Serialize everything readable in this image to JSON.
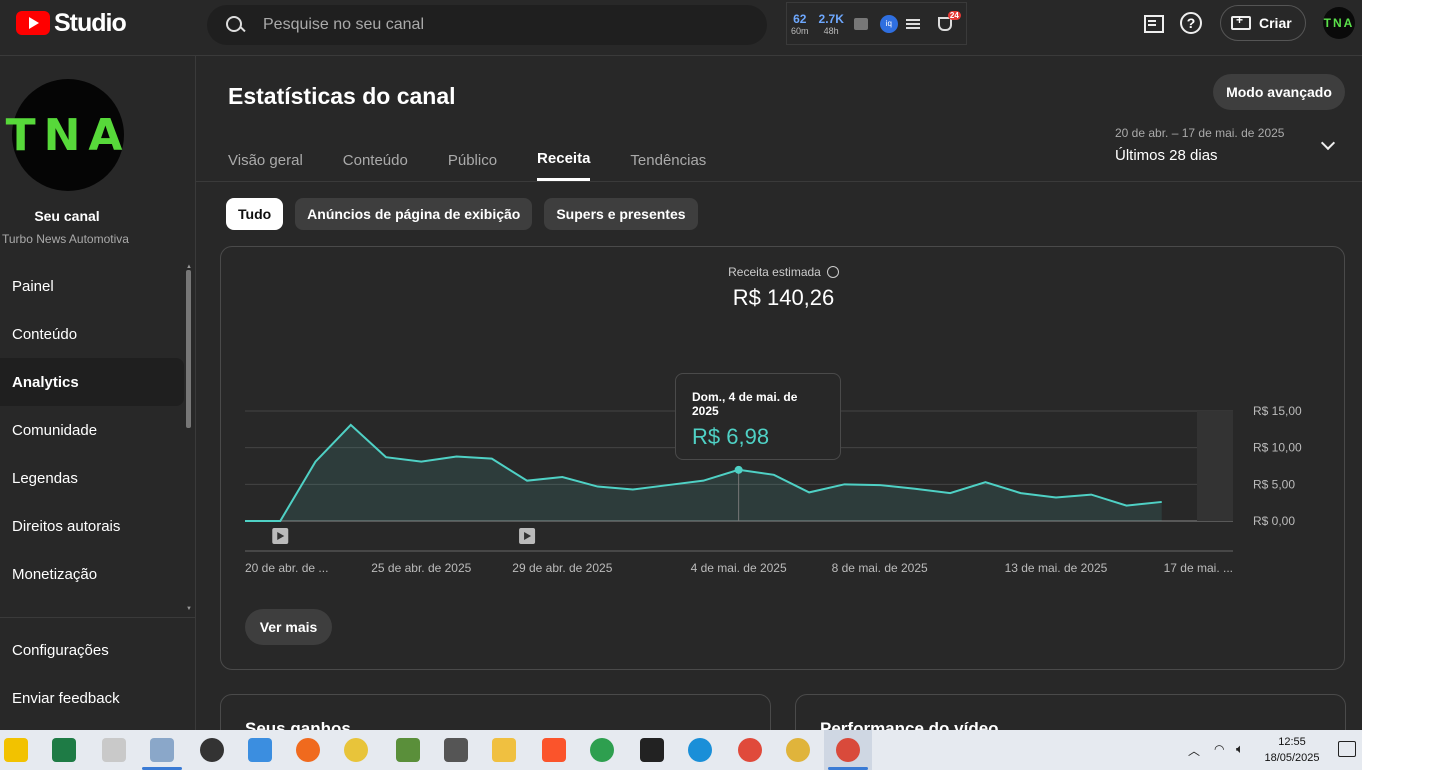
{
  "header": {
    "logo_text": "Studio",
    "search_placeholder": "Pesquise no seu canal",
    "extension": {
      "stat1_value": "62",
      "stat1_sub": "60m",
      "stat2_value": "2.7K",
      "stat2_sub": "48h",
      "badge_count": "24"
    },
    "create_label": "Criar",
    "avatar_text": "TNA"
  },
  "sidebar": {
    "avatar_text": "TNA",
    "channel_title": "Seu canal",
    "channel_name": "Turbo News Automotiva",
    "items": [
      {
        "label": "Painel"
      },
      {
        "label": "Conteúdo"
      },
      {
        "label": "Analytics"
      },
      {
        "label": "Comunidade"
      },
      {
        "label": "Legendas"
      },
      {
        "label": "Direitos autorais"
      },
      {
        "label": "Monetização"
      }
    ],
    "bottom_items": [
      {
        "label": "Configurações"
      },
      {
        "label": "Enviar feedback"
      }
    ]
  },
  "main": {
    "title": "Estatísticas do canal",
    "advanced_mode": "Modo avançado",
    "tabs": [
      {
        "label": "Visão geral"
      },
      {
        "label": "Conteúdo"
      },
      {
        "label": "Público"
      },
      {
        "label": "Receita"
      },
      {
        "label": "Tendências"
      }
    ],
    "date_range": "20 de abr. – 17 de mai. de 2025",
    "period": "Últimos 28 dias",
    "chips": [
      {
        "label": "Tudo"
      },
      {
        "label": "Anúncios de página de exibição"
      },
      {
        "label": "Supers e presentes"
      }
    ],
    "metric_label": "Receita estimada",
    "metric_value": "R$ 140,26",
    "tooltip_date": "Dom., 4 de mai. de 2025",
    "tooltip_value": "R$ 6,98",
    "see_more": "Ver mais",
    "card_earnings": "Seus ganhos",
    "card_video_perf": "Performance do vídeo"
  },
  "chart_data": {
    "type": "area",
    "title": "",
    "xlabel": "",
    "ylabel": "",
    "x_tick_labels": [
      "20 de abr. de ...",
      "25 de abr. de 2025",
      "29 de abr. de 2025",
      "4 de mai. de 2025",
      "8 de mai. de 2025",
      "13 de mai. de 2025",
      "17 de mai. ..."
    ],
    "y_tick_labels": [
      "R$ 0,00",
      "R$ 5,00",
      "R$ 10,00",
      "R$ 15,00"
    ],
    "ylim": [
      0,
      15
    ],
    "x": [
      "2025-04-20",
      "2025-04-21",
      "2025-04-22",
      "2025-04-23",
      "2025-04-24",
      "2025-04-25",
      "2025-04-26",
      "2025-04-27",
      "2025-04-28",
      "2025-04-29",
      "2025-04-30",
      "2025-05-01",
      "2025-05-02",
      "2025-05-03",
      "2025-05-04",
      "2025-05-05",
      "2025-05-06",
      "2025-05-07",
      "2025-05-08",
      "2025-05-09",
      "2025-05-10",
      "2025-05-11",
      "2025-05-12",
      "2025-05-13",
      "2025-05-14",
      "2025-05-15",
      "2025-05-16",
      "2025-05-17"
    ],
    "series": [
      {
        "values": [
          0.0,
          0.0,
          8.1,
          13.1,
          8.7,
          8.1,
          8.8,
          8.5,
          5.5,
          6.0,
          4.7,
          4.3,
          4.9,
          5.5,
          6.98,
          6.3,
          3.9,
          5.0,
          4.9,
          4.4,
          3.8,
          5.3,
          3.8,
          3.2,
          3.6,
          2.1,
          2.6,
          null
        ]
      }
    ],
    "highlight_date": "2025-05-04",
    "grid": true,
    "color": "#4fd1c5"
  },
  "taskbar": {
    "time": "12:55",
    "date": "18/05/2025"
  }
}
